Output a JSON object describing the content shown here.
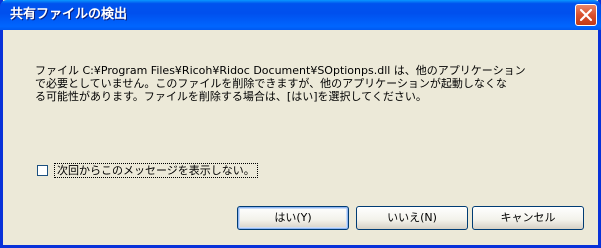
{
  "window": {
    "title": "共有ファイルの検出",
    "close_icon": "close-icon"
  },
  "message": {
    "lines": [
      "ファイル C:¥Program Files¥Ricoh¥Ridoc Document¥SOptionps.dll は、他のアプリケーション",
      "で必要としていません。このファイルを削除できますが、他のアプリケーションが起動しなくな",
      "る可能性があります。ファイルを削除する場合は、[はい]を選択してください。"
    ]
  },
  "checkbox": {
    "label": "次回からこのメッセージを表示しない。",
    "checked": false
  },
  "buttons": {
    "yes": "はい(Y)",
    "no": "いいえ(N)",
    "cancel": "キャンセル"
  },
  "colors": {
    "titlebar": "#0055ea",
    "frame": "#0831d9",
    "dialog_bg": "#ece9d8",
    "close_button": "#d9502d"
  }
}
